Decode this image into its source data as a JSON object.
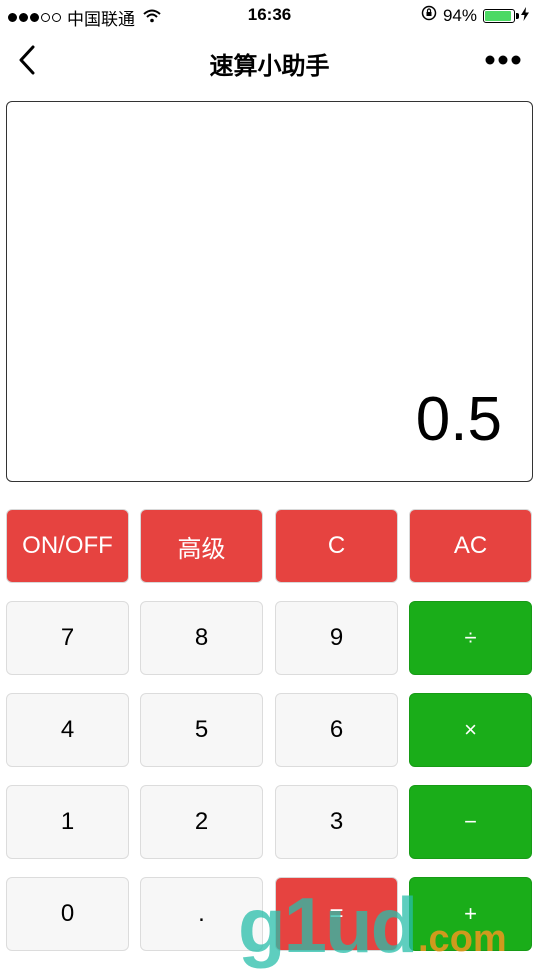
{
  "status_bar": {
    "carrier": "中国联通",
    "time": "16:36",
    "battery_percent": "94%",
    "battery_level": 0.94
  },
  "navbar": {
    "title": "速算小助手"
  },
  "display": {
    "value": "0.5"
  },
  "keys": {
    "on_off": "ON/OFF",
    "advanced": "高级",
    "clear": "C",
    "all_clear": "AC",
    "seven": "7",
    "eight": "8",
    "nine": "9",
    "divide": "÷",
    "four": "4",
    "five": "5",
    "six": "6",
    "multiply": "×",
    "one": "1",
    "two": "2",
    "three": "3",
    "minus": "−",
    "zero": "0",
    "dot": ".",
    "equals": "=",
    "plus": "+"
  },
  "watermark": {
    "text": "g1ud",
    "domain": ".com"
  },
  "colors": {
    "red_key": "#e64340",
    "green_key": "#1aad19",
    "gray_key": "#f7f7f7"
  }
}
